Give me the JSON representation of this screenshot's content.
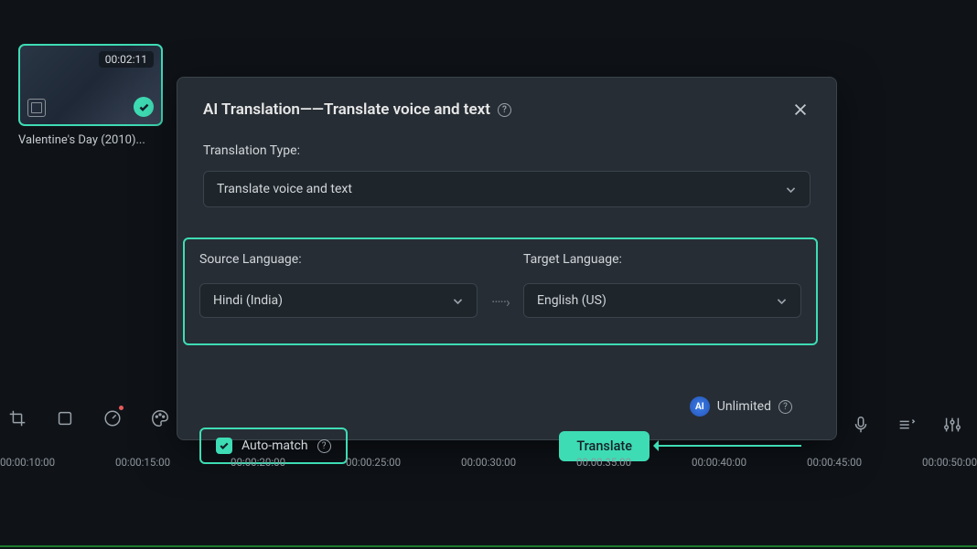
{
  "thumbnail": {
    "duration": "00:02:11",
    "title": "Valentine's Day (2010)..."
  },
  "modal": {
    "title": "AI Translation——Translate voice and text",
    "translation_type": {
      "label": "Translation Type:",
      "value": "Translate voice and text"
    },
    "source": {
      "label": "Source Language:",
      "value": "Hindi (India)"
    },
    "target": {
      "label": "Target Language:",
      "value": "English (US)"
    },
    "unlimited": "Unlimited",
    "auto_match": "Auto-match",
    "translate_btn": "Translate"
  },
  "timeline": [
    "00:00:10:00",
    "00:00:15:00",
    "00:00:20:00",
    "00:00:25:00",
    "00:00:30:00",
    "00:00:35:00",
    "00:00:40:00",
    "00:00:45:00",
    "00:00:50:00"
  ]
}
